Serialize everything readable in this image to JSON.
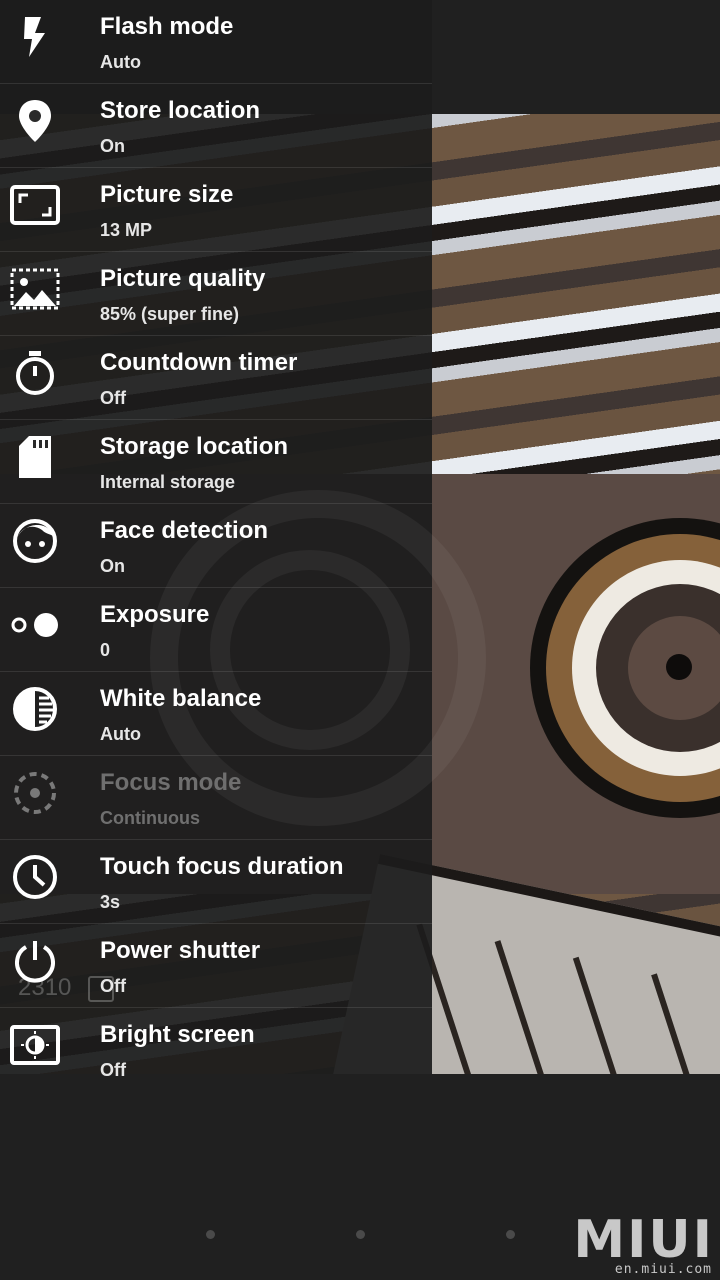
{
  "settings": [
    {
      "title": "Flash mode",
      "value": "Auto",
      "icon": "flash-icon"
    },
    {
      "title": "Store location",
      "value": "On",
      "icon": "location-pin-icon"
    },
    {
      "title": "Picture size",
      "value": "13 MP",
      "icon": "picture-size-icon"
    },
    {
      "title": "Picture quality",
      "value": "85% (super fine)",
      "icon": "picture-quality-icon"
    },
    {
      "title": "Countdown timer",
      "value": "Off",
      "icon": "stopwatch-icon"
    },
    {
      "title": "Storage location",
      "value": "Internal storage",
      "icon": "sd-card-icon"
    },
    {
      "title": "Face detection",
      "value": "On",
      "icon": "face-icon"
    },
    {
      "title": "Exposure",
      "value": "0",
      "icon": "exposure-icon"
    },
    {
      "title": "White balance",
      "value": "Auto",
      "icon": "white-balance-icon"
    },
    {
      "title": "Focus mode",
      "value": "Continuous",
      "icon": "focus-icon",
      "disabled": true
    },
    {
      "title": "Touch focus duration",
      "value": "3s",
      "icon": "clock-icon"
    },
    {
      "title": "Power shutter",
      "value": "Off",
      "icon": "power-icon"
    },
    {
      "title": "Bright screen",
      "value": "Off",
      "icon": "bright-screen-icon"
    }
  ],
  "overlay": {
    "photo_count": "2310"
  },
  "watermark": {
    "brand": "MIUI",
    "site": "en.miui.com"
  },
  "colors": {
    "background": "#202020",
    "text": "#ffffff",
    "disabled_text": "#6f6f6f"
  }
}
